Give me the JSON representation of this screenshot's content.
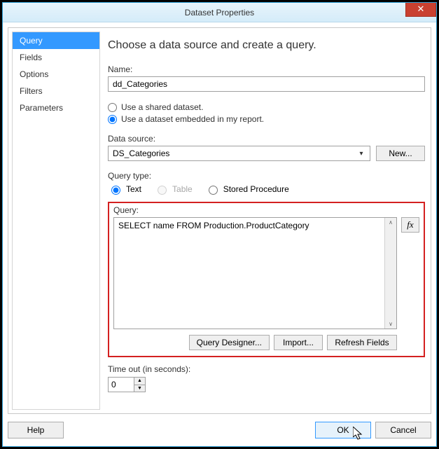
{
  "window": {
    "title": "Dataset Properties",
    "close_glyph": "✕"
  },
  "sidebar": {
    "items": [
      {
        "label": "Query"
      },
      {
        "label": "Fields"
      },
      {
        "label": "Options"
      },
      {
        "label": "Filters"
      },
      {
        "label": "Parameters"
      }
    ],
    "selected_index": 0
  },
  "page": {
    "heading": "Choose a data source and create a query.",
    "name_label": "Name:",
    "name_value": "dd_Categories",
    "dataset_mode": {
      "shared_label": "Use a shared dataset.",
      "embedded_label": "Use a dataset embedded in my report.",
      "selected": "embedded"
    },
    "data_source": {
      "label": "Data source:",
      "value": "DS_Categories",
      "new_button": "New..."
    },
    "query_type": {
      "label": "Query type:",
      "options": {
        "text": "Text",
        "table": "Table",
        "stored_proc": "Stored Procedure"
      },
      "selected": "text",
      "table_disabled": true
    },
    "query": {
      "label": "Query:",
      "text": "SELECT name FROM Production.ProductCategory",
      "fx_label": "fx",
      "buttons": {
        "designer": "Query Designer...",
        "import": "Import...",
        "refresh": "Refresh Fields"
      }
    },
    "timeout": {
      "label": "Time out (in seconds):",
      "value": "0"
    }
  },
  "footer": {
    "help": "Help",
    "ok": "OK",
    "cancel": "Cancel"
  }
}
